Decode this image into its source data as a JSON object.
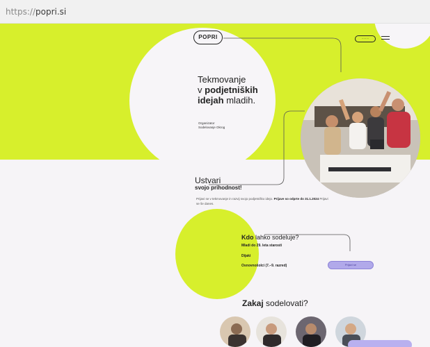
{
  "browser": {
    "url_scheme": "https://",
    "url_host": "popri.si"
  },
  "header": {
    "logo_text": "POPRI",
    "nav_pill_label": "········",
    "menu_icon": "hamburger-icon"
  },
  "hero": {
    "headline_line1": "Tekmovanje",
    "headline_line2_prefix": "v ",
    "headline_line2_bold": "podjetniških",
    "headline_line3_bold": "idejah",
    "headline_line3_rest": " mladih.",
    "subnote": "Organizator Sodelovanje Okrog"
  },
  "intro": {
    "title_line1": "Ustvari",
    "title_line2": "svojo prihodnost!",
    "body": "Prijavi se v tekmovanje in razvij svojo podjetniško idejo. ",
    "body_bold": "Prijave so odprte do 31.1.2024",
    "body_end": " Prijavi se še danes."
  },
  "eligibility": {
    "title_bold": "Kdo",
    "title_rest": " lahko sodeluje?",
    "items": [
      "Mladi do 29. leta starosti",
      "Dijaki",
      "Osnovnošolci (7.–9. razred)"
    ],
    "button_label": "Prijavi se"
  },
  "why": {
    "title_bold": "Zakaj",
    "title_rest": " sodelovati?"
  },
  "colors": {
    "lime": "#d7ef2c",
    "lavender": "#b1a9ea",
    "background": "#f6f4f7",
    "text": "#222222"
  }
}
